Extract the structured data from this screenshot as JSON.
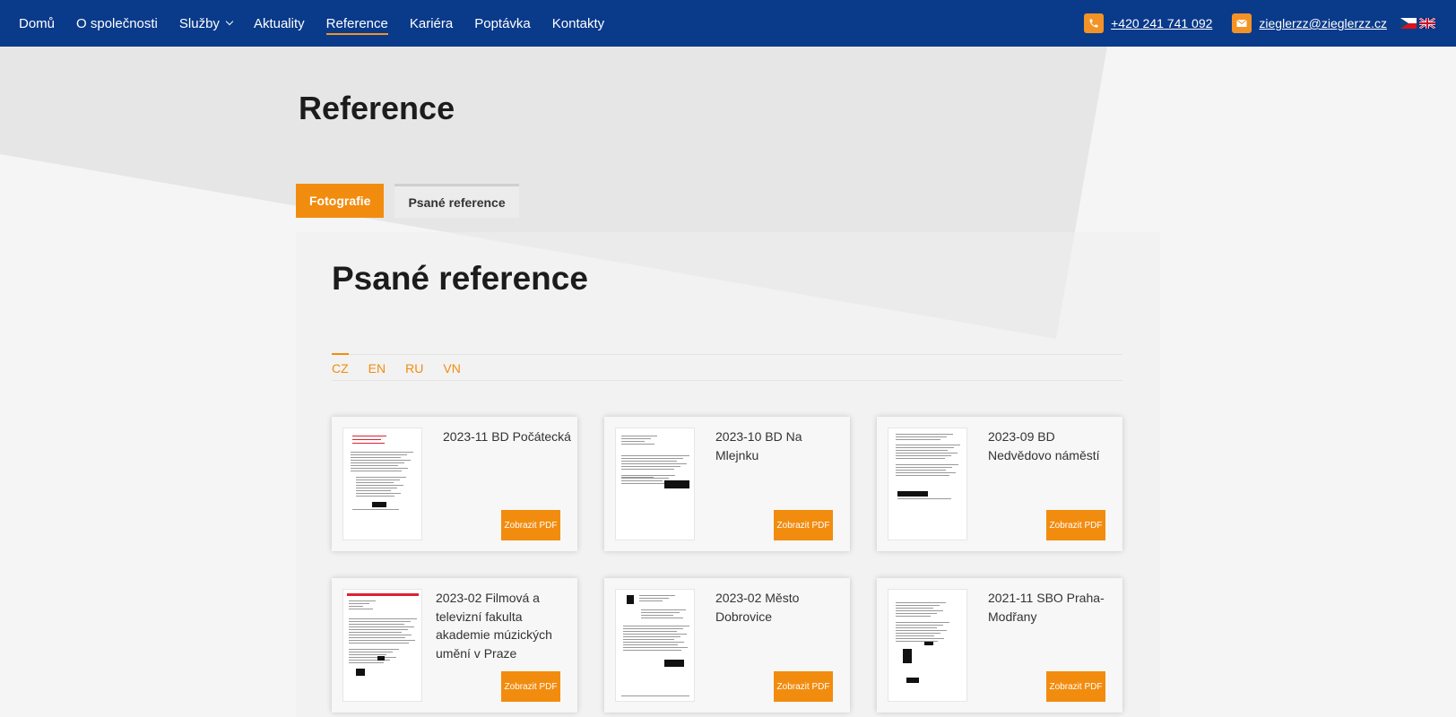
{
  "nav": {
    "items": [
      {
        "label": "Domů",
        "name": "nav-home"
      },
      {
        "label": "O společnosti",
        "name": "nav-about"
      },
      {
        "label": "Služby",
        "name": "nav-services",
        "dropdown": true
      },
      {
        "label": "Aktuality",
        "name": "nav-news"
      },
      {
        "label": "Reference",
        "name": "nav-references",
        "active": true
      },
      {
        "label": "Kariéra",
        "name": "nav-career"
      },
      {
        "label": "Poptávka",
        "name": "nav-inquiry"
      },
      {
        "label": "Kontakty",
        "name": "nav-contacts"
      }
    ],
    "phone": "+420 241 741 092",
    "email": "zieglerzz@zieglerzz.cz",
    "languages": [
      "cz-flag-icon",
      "uk-flag-icon"
    ]
  },
  "page": {
    "title": "Reference"
  },
  "tabs": [
    {
      "label": "Fotografie",
      "active": true
    },
    {
      "label": "Psané reference",
      "active": false
    }
  ],
  "section": {
    "title": "Psané reference",
    "langs": [
      {
        "label": "CZ",
        "active": true
      },
      {
        "label": "EN",
        "active": false
      },
      {
        "label": "RU",
        "active": false
      },
      {
        "label": "VN",
        "active": false
      }
    ]
  },
  "cards": [
    {
      "title": "2023-11 BD Počátecká",
      "button": "Zobrazit PDF",
      "variant": 1
    },
    {
      "title": "2023-10 BD Na Mlejnku",
      "button": "Zobrazit PDF",
      "variant": 2
    },
    {
      "title": "2023-09 BD Nedvědovo náměstí",
      "button": "Zobrazit PDF",
      "variant": 3
    },
    {
      "title": "2023-02 Filmová a televizní fakulta akademie múzických umění v Praze",
      "button": "Zobrazit PDF",
      "variant": 4
    },
    {
      "title": "2023-02 Město Dobrovice",
      "button": "Zobrazit PDF",
      "variant": 5
    },
    {
      "title": "2021-11 SBO Praha-Modřany",
      "button": "Zobrazit PDF",
      "variant": 6
    }
  ],
  "colors": {
    "nav_bg": "#0a3a8a",
    "accent": "#f28c0f"
  }
}
